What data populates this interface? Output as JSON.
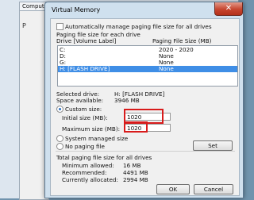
{
  "background": {
    "tab_label": "Compute",
    "panel_letter": "P"
  },
  "dialog": {
    "title": "Virtual Memory",
    "close_label": "✕"
  },
  "auto_manage": {
    "label": "Automatically manage paging file size for all drives",
    "checked": false
  },
  "drives_section": {
    "heading": "Paging file size for each drive",
    "col_drive": "Drive  [Volume Label]",
    "col_size": "Paging File Size (MB)",
    "rows": [
      {
        "drive": "C:",
        "size": "2020 - 2020",
        "selected": false
      },
      {
        "drive": "D:",
        "size": "None",
        "selected": false
      },
      {
        "drive": "G:",
        "size": "None",
        "selected": false
      },
      {
        "drive": "H:      [FLASH DRIVE]",
        "size": "None",
        "selected": true
      }
    ]
  },
  "selected_drive": {
    "label": "Selected drive:",
    "value": "H:  [FLASH DRIVE]",
    "space_label": "Space available:",
    "space_value": "3946 MB"
  },
  "custom_size": {
    "label": "Custom size:",
    "initial_label": "Initial size (MB):",
    "initial_value": "1020",
    "maximum_label": "Maximum size (MB):",
    "maximum_value": "1020"
  },
  "system_managed_label": "System managed size",
  "no_paging_label": "No paging file",
  "set_label": "Set",
  "totals": {
    "heading": "Total paging file size for all drives",
    "min_label": "Minimum allowed:",
    "min_value": "16 MB",
    "rec_label": "Recommended:",
    "rec_value": "4491 MB",
    "cur_label": "Currently allocated:",
    "cur_value": "2994 MB"
  },
  "buttons": {
    "ok": "OK",
    "cancel": "Cancel"
  },
  "colors": {
    "highlight_border": "#d81b1b",
    "selection": "#3f8ee6"
  }
}
